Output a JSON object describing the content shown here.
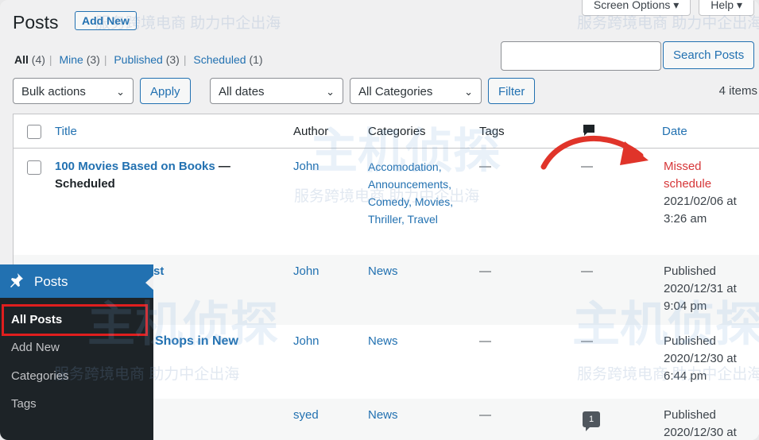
{
  "header": {
    "title": "Posts",
    "add_new": "Add New",
    "screen_options": "Screen Options ▾",
    "help": "Help ▾"
  },
  "views": {
    "all": "All",
    "all_count": "(4)",
    "mine": "Mine",
    "mine_count": "(3)",
    "published": "Published",
    "published_count": "(3)",
    "scheduled": "Scheduled",
    "scheduled_count": "(1)"
  },
  "search": {
    "placeholder": "",
    "button": "Search Posts"
  },
  "filters": {
    "bulk_actions": "Bulk actions",
    "apply": "Apply",
    "dates": "All dates",
    "categories": "All Categories",
    "filter": "Filter",
    "items_count": "4 items"
  },
  "table": {
    "columns": {
      "title": "Title",
      "author": "Author",
      "categories": "Categories",
      "tags": "Tags",
      "date": "Date"
    },
    "rows": [
      {
        "title": "100 Movies Based on Books",
        "state": " — Scheduled",
        "author": "John",
        "categories": "Accomodation, Announcements, Comedy, Movies, Thriller, Travel",
        "tags": "—",
        "comments": "—",
        "status": "Missed schedule",
        "date": "2021/02/06 at 3:26 am"
      },
      {
        "title": "st",
        "author": "John",
        "categories": "News",
        "tags": "—",
        "comments": "—",
        "status": "Published",
        "date": "2020/12/31 at 9:04 pm"
      },
      {
        "title": "Shops in New",
        "author": "John",
        "categories": "News",
        "tags": "—",
        "comments": "—",
        "status": "Published",
        "date": "2020/12/30 at 6:44 pm"
      },
      {
        "title": "",
        "author": "syed",
        "categories": "News",
        "tags": "—",
        "comments": "1",
        "status": "Published",
        "date": "2020/12/30 at"
      }
    ]
  },
  "sidebar": {
    "section": "Posts",
    "items": [
      "All Posts",
      "Add New",
      "Categories",
      "Tags"
    ]
  },
  "watermarks": {
    "text_cn": "服务跨境电商 助力中企出海",
    "text_cn_short": "服务跨境电商",
    "brand": "主机侦探"
  },
  "colors": {
    "accent": "#2271b1",
    "missed": "#d63638",
    "sidebar_bg": "#1d2327",
    "highlight": "#e01e1e"
  }
}
